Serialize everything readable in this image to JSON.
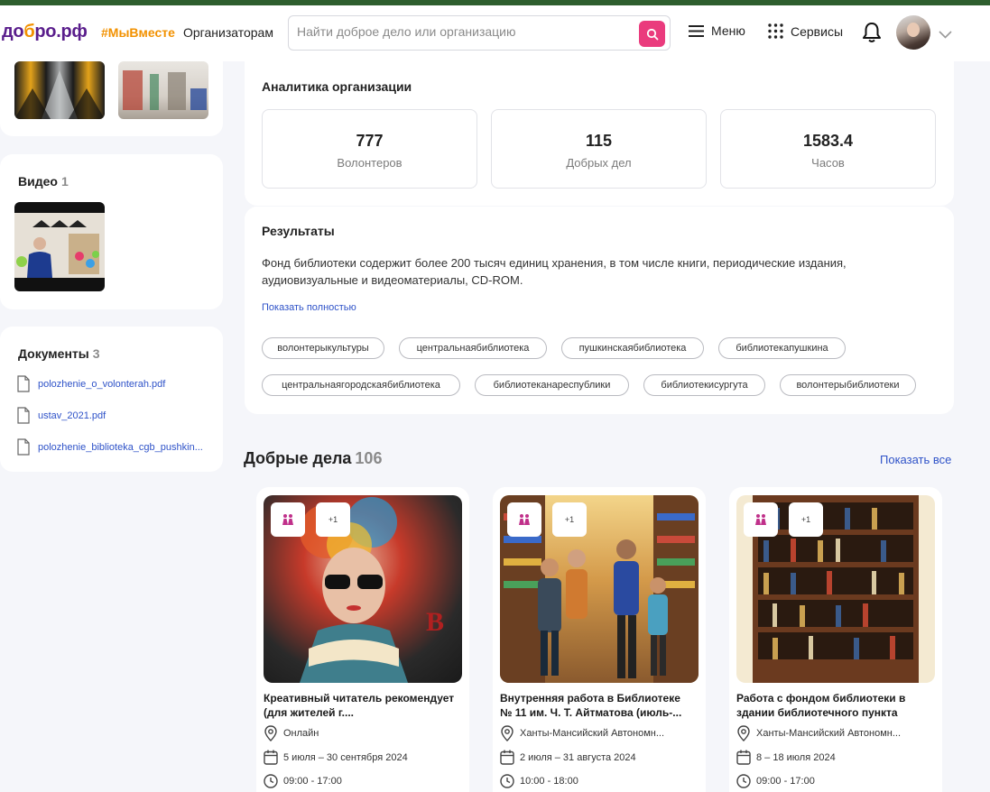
{
  "header": {
    "logo": "добро.рф",
    "hashtag": "#МыВместе",
    "organizers": "Организаторам",
    "search_placeholder": "Найти доброе дело или организацию",
    "menu_label": "Меню",
    "services_label": "Сервисы"
  },
  "sidebar": {
    "video": {
      "title": "Видео",
      "count": "1"
    },
    "documents": {
      "title": "Документы",
      "count": "3",
      "items": [
        {
          "name": "polozhenie_o_volonterah.pdf"
        },
        {
          "name": "ustav_2021.pdf"
        },
        {
          "name": "polozhenie_biblioteka_cgb_pushkin..."
        }
      ]
    }
  },
  "analytics": {
    "title": "Аналитика организации",
    "stats": [
      {
        "value": "777",
        "label": "Волонтеров"
      },
      {
        "value": "115",
        "label": "Добрых дел"
      },
      {
        "value": "1583.4",
        "label": "Часов"
      }
    ]
  },
  "results": {
    "title": "Результаты",
    "text": "Фонд библиотеки содержит более 200 тысяч единиц хранения, в том числе книги, периодические издания, аудиовизуальные и видеоматериалы, CD-ROM.",
    "show_full": "Показать полностью",
    "tags": [
      "волонтерыкультуры",
      "центральнаябиблиотека",
      "пушкинскаябиблиотека",
      "библиотекапушкина",
      "центральнаягородскаябиблиотека",
      "библиотеканареспублики",
      "библиотекисургута",
      "волонтерыбиблиотеки"
    ]
  },
  "deeds": {
    "title": "Добрые дела",
    "count": "106",
    "show_all": "Показать все",
    "cards": [
      {
        "plus": "+1",
        "title": "Креативный читатель рекомендует (для жителей г....",
        "location": "Онлайн",
        "dates": "5 июля – 30 сентября 2024",
        "time": "09:00 - 17:00"
      },
      {
        "plus": "+1",
        "title": "Внутренняя работа в Библиотеке № 11 им. Ч. Т. Айтматова (июль-...",
        "location": "Ханты-Мансийский Автономн...",
        "dates": "2 июля – 31 августа 2024",
        "time": "10:00 - 18:00"
      },
      {
        "plus": "+1",
        "title": "Работа с фондом библиотеки в здании библиотечного пункта",
        "location": "Ханты-Мансийский Автономн...",
        "dates": "8 – 18 июля 2024",
        "time": "09:00 - 17:00"
      }
    ]
  },
  "colors": {
    "accent": "#ea3b7d",
    "brand": "#5a1e8c",
    "hashtag": "#f29100",
    "link": "#2e52c8"
  }
}
